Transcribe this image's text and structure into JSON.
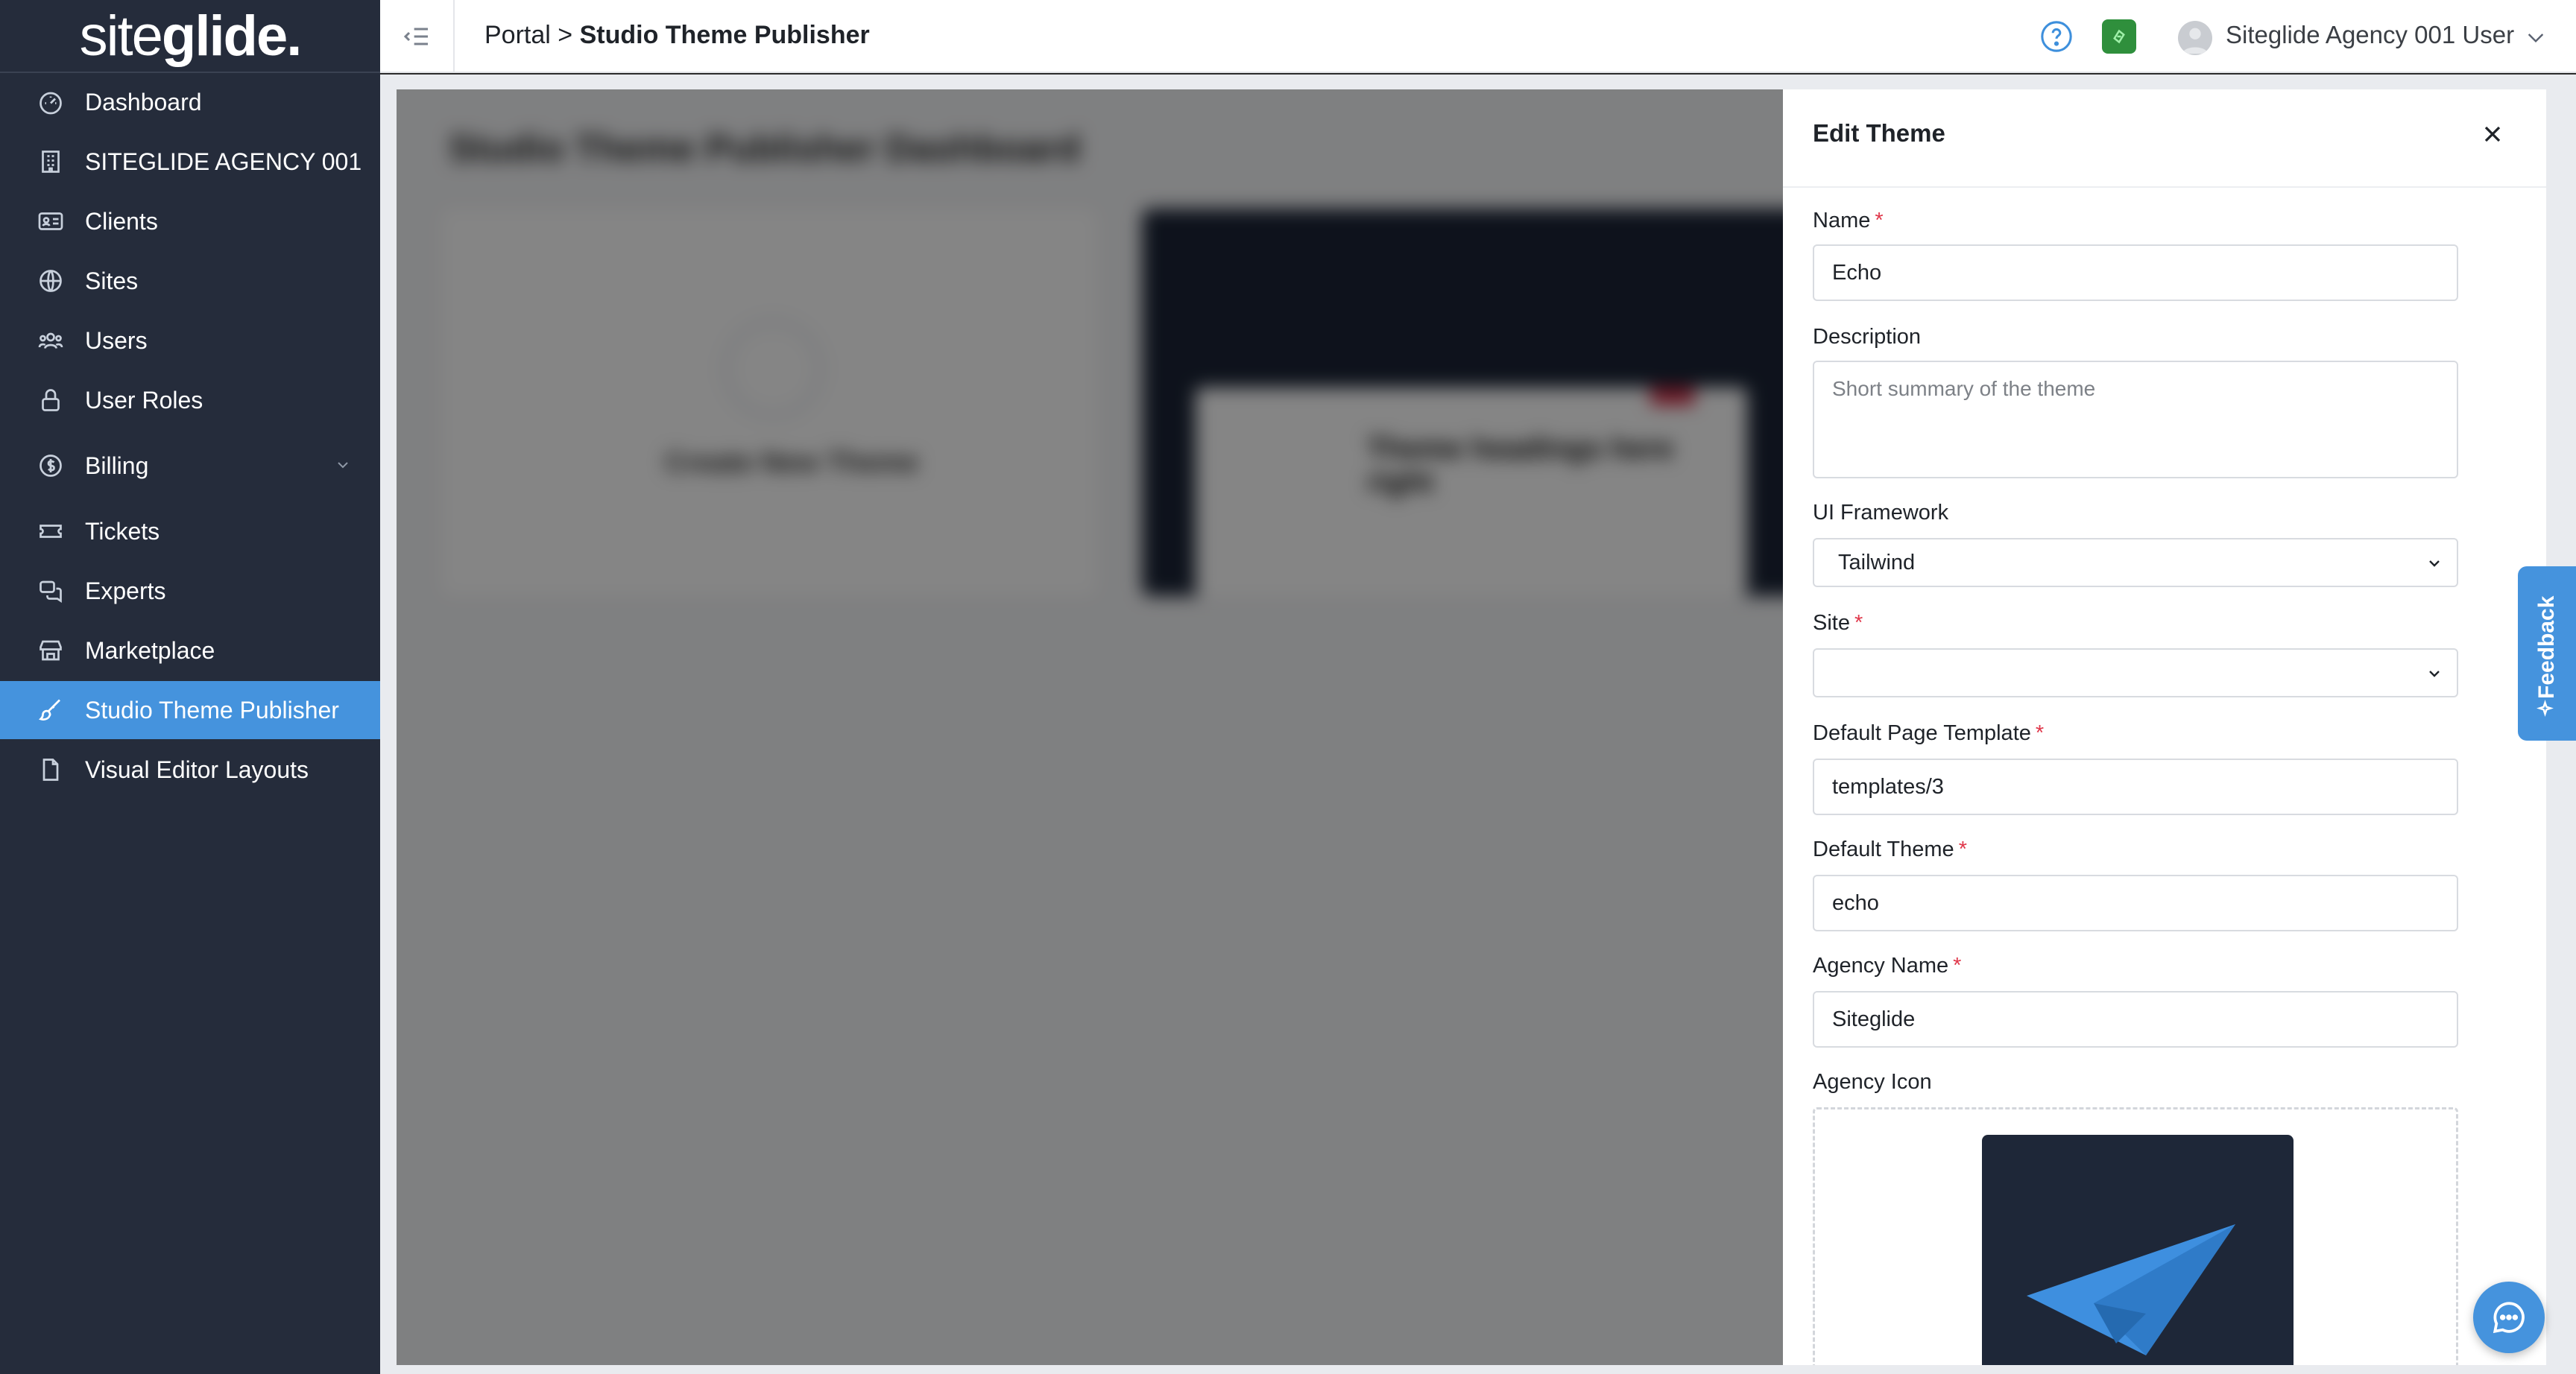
{
  "sidebar": {
    "logo_prefix": "site",
    "logo_suffix": "glide.",
    "items": [
      {
        "label": "Dashboard",
        "icon": "dashboard-icon"
      },
      {
        "label": "SITEGLIDE AGENCY 001",
        "icon": "building-icon"
      },
      {
        "label": "Clients",
        "icon": "id-card-icon"
      },
      {
        "label": "Sites",
        "icon": "globe-icon"
      },
      {
        "label": "Users",
        "icon": "users-icon"
      },
      {
        "label": "User Roles",
        "icon": "lock-icon"
      },
      {
        "label": "Billing",
        "icon": "dollar-icon"
      },
      {
        "label": "Tickets",
        "icon": "ticket-icon"
      },
      {
        "label": "Experts",
        "icon": "chat-icon"
      },
      {
        "label": "Marketplace",
        "icon": "store-icon"
      },
      {
        "label": "Studio Theme Publisher",
        "icon": "brush-icon",
        "active": true
      },
      {
        "label": "Visual Editor Layouts",
        "icon": "file-icon"
      }
    ]
  },
  "header": {
    "breadcrumb_root": "Portal",
    "breadcrumb_sep": ">",
    "breadcrumb_current": "Studio Theme Publisher",
    "user_name": "Siteglide Agency 001 User"
  },
  "background": {
    "title": "Studio Theme Publisher Dashboard",
    "card1_label": "Create New Theme",
    "card2_text": "Theme headings here right"
  },
  "panel": {
    "title": "Edit Theme",
    "name_label": "Name",
    "name_value": "Echo",
    "description_label": "Description",
    "description_placeholder": "Short summary of the theme",
    "ui_framework_label": "UI Framework",
    "ui_framework_value": "Tailwind",
    "site_label": "Site",
    "site_value": "",
    "default_page_template_label": "Default Page Template",
    "default_page_template_value": "templates/3",
    "default_theme_label": "Default Theme",
    "default_theme_value": "echo",
    "agency_name_label": "Agency Name",
    "agency_name_value": "Siteglide",
    "agency_icon_label": "Agency Icon",
    "required_mark": "*"
  },
  "widgets": {
    "feedback_label": "Feedback"
  },
  "colors": {
    "sidebar_bg": "#252c3b",
    "accent": "#4593dd",
    "required": "#e0384b"
  }
}
